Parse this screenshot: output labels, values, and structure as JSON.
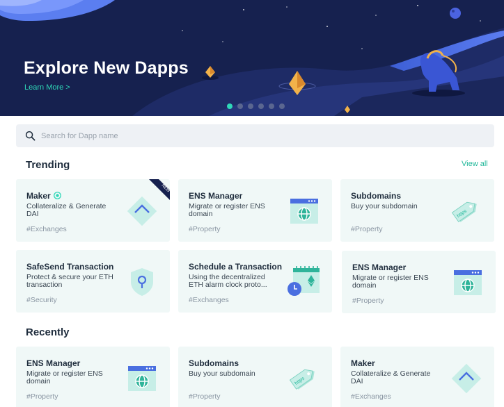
{
  "hero": {
    "title": "Explore New Dapps",
    "link": "Learn More >",
    "slides": 6,
    "active_slide": 0
  },
  "search": {
    "placeholder": "Search for Dapp name"
  },
  "trending": {
    "title": "Trending",
    "view_all": "View all",
    "cards": [
      {
        "name": "Maker",
        "desc": "Collateralize & Generate DAI",
        "tag": "#Exchanges",
        "icon": "maker-icon",
        "badge": "NEW",
        "verified": true
      },
      {
        "name": "ENS Manager",
        "desc": "Migrate or register ENS domain",
        "tag": "#Property",
        "icon": "ens-browser-icon"
      },
      {
        "name": "Subdomains",
        "desc": "Buy your subdomain",
        "tag": "#Property",
        "icon": "https-tag-icon"
      },
      {
        "name": "SafeSend Transaction",
        "desc": "Protect & secure your ETH transaction",
        "tag": "#Security",
        "icon": "shield-lock-icon"
      },
      {
        "name": "Schedule a Transaction",
        "desc": "Using the decentralized ETH alarm clock proto...",
        "tag": "#Exchanges",
        "icon": "calendar-clock-icon"
      },
      {
        "name": "ENS Manager",
        "desc": "Migrate or register ENS domain",
        "tag": "#Property",
        "icon": "ens-browser-icon"
      }
    ]
  },
  "recently": {
    "title": "Recently",
    "cards": [
      {
        "name": "ENS Manager",
        "desc": "Migrate or register ENS domain",
        "tag": "#Property",
        "icon": "ens-browser-icon"
      },
      {
        "name": "Subdomains",
        "desc": "Buy your subdomain",
        "tag": "#Property",
        "icon": "https-tag-icon"
      },
      {
        "name": "Maker",
        "desc": "Collateralize & Generate DAI",
        "tag": "#Exchanges",
        "icon": "maker-icon"
      }
    ]
  },
  "colors": {
    "accent": "#2fd8b8",
    "hero_bg": "#16214f",
    "card_bg": "#f0f8f7",
    "link": "#21b89a"
  }
}
